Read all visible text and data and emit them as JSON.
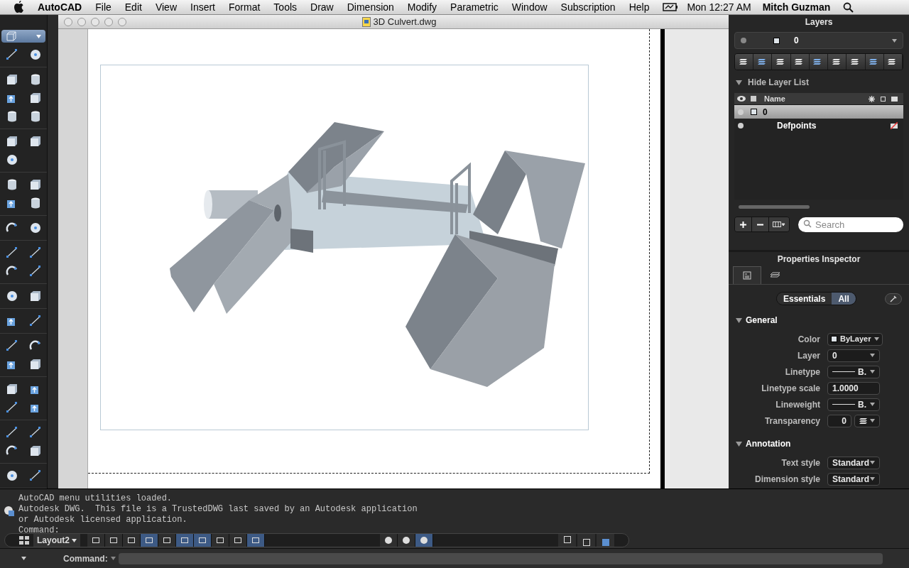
{
  "menu_bar": {
    "app": "AutoCAD",
    "items": [
      "File",
      "Edit",
      "View",
      "Insert",
      "Format",
      "Tools",
      "Draw",
      "Dimension",
      "Modify",
      "Parametric",
      "Window",
      "Subscription",
      "Help"
    ],
    "clock": "Mon 12:27 AM",
    "user": "Mitch Guzman"
  },
  "document": {
    "title": "3D Culvert.dwg"
  },
  "layers_panel": {
    "title": "Layers",
    "current_layer": "0",
    "list_toggle": "Hide Layer List",
    "expanded": true,
    "name_column": "Name",
    "rows": [
      {
        "name": "0",
        "selected": true,
        "no_plot": false
      },
      {
        "name": "Defpoints",
        "selected": false,
        "no_plot": true
      }
    ],
    "search": {
      "placeholder": "Search"
    }
  },
  "properties_panel": {
    "title": "Properties Inspector",
    "modes": [
      {
        "label": "Essentials",
        "selected": false
      },
      {
        "label": "All",
        "selected": true
      }
    ],
    "sections": [
      {
        "title": "General",
        "expanded": true,
        "fields": [
          {
            "label": "Color",
            "value": "ByLayer",
            "kind": "swatch"
          },
          {
            "label": "Layer",
            "value": "0",
            "kind": "dropdown"
          },
          {
            "label": "Linetype",
            "value": "B.",
            "kind": "line"
          },
          {
            "label": "Linetype scale",
            "value": "1.0000",
            "kind": "input"
          },
          {
            "label": "Lineweight",
            "value": "B.",
            "kind": "line"
          },
          {
            "label": "Transparency",
            "value": "0",
            "kind": "transparency"
          }
        ]
      },
      {
        "title": "Annotation",
        "expanded": true,
        "fields": [
          {
            "label": "Text style",
            "value": "Standard",
            "kind": "dropdown"
          },
          {
            "label": "Dimension style",
            "value": "Standard",
            "kind": "dropdown"
          }
        ]
      }
    ]
  },
  "command_history": [
    "AutoCAD menu utilities loaded.",
    "Autodesk DWG.  This file is a TrustedDWG last saved by an Autodesk application",
    "or Autodesk licensed application.",
    "Command:"
  ],
  "status_bar": {
    "layout": "Layout2",
    "toggles": [
      {
        "on": false
      },
      {
        "on": false
      },
      {
        "on": false
      },
      {
        "on": true
      },
      {
        "on": false
      },
      {
        "on": true
      },
      {
        "on": true
      },
      {
        "on": false
      },
      {
        "on": false
      },
      {
        "on": true
      }
    ],
    "navigation": [
      {
        "on": false
      },
      {
        "on": false
      },
      {
        "on": true
      }
    ]
  },
  "command_line": {
    "label": "Command:"
  }
}
